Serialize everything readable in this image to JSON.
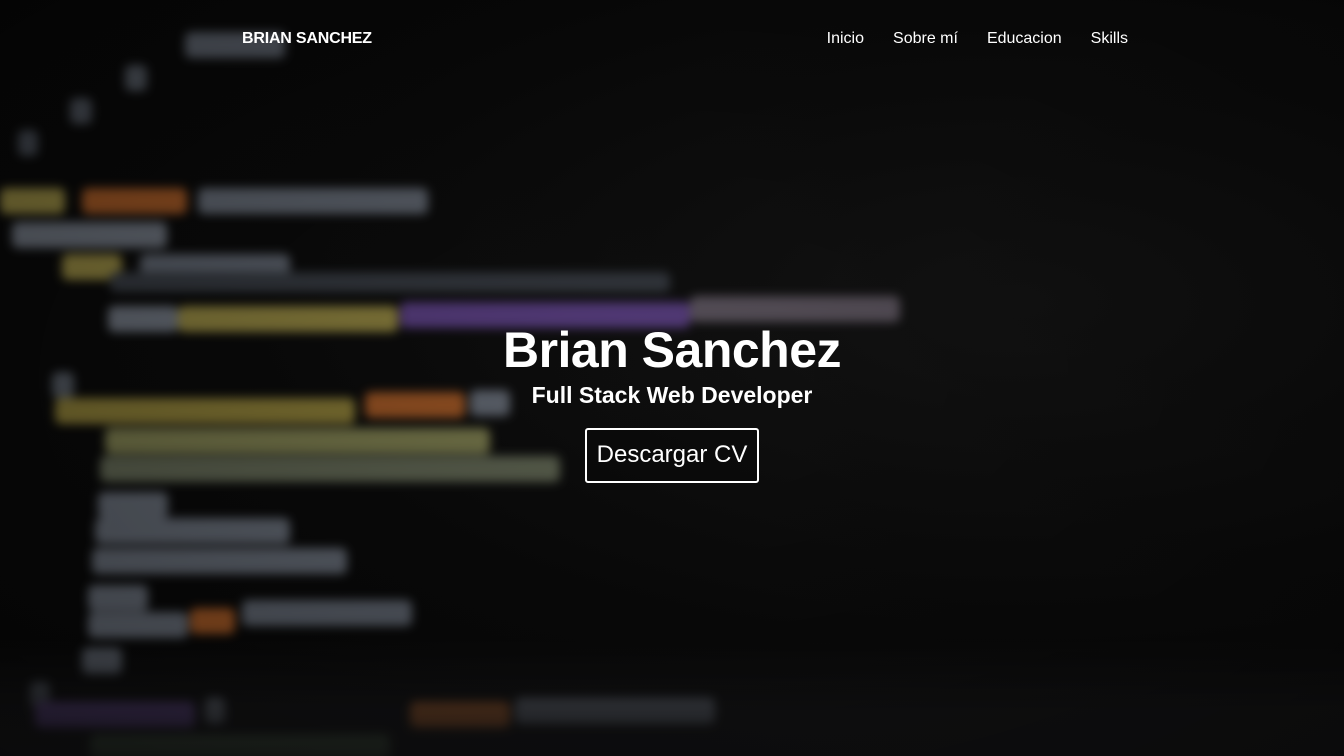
{
  "nav": {
    "brand": "BRIAN SANCHEZ",
    "links": [
      "Inicio",
      "Sobre mí",
      "Educacion",
      "Skills"
    ]
  },
  "hero": {
    "name": "Brian Sanchez",
    "role": "Full Stack Web Developer",
    "cta_label": "Descargar CV"
  },
  "colors": {
    "text": "#ffffff",
    "background": "#0d0d0d",
    "code_yellow": "#b8a04a",
    "code_orange": "#c46a2a",
    "code_purple": "#6a4a9a",
    "code_gray": "#7a7f8a"
  }
}
